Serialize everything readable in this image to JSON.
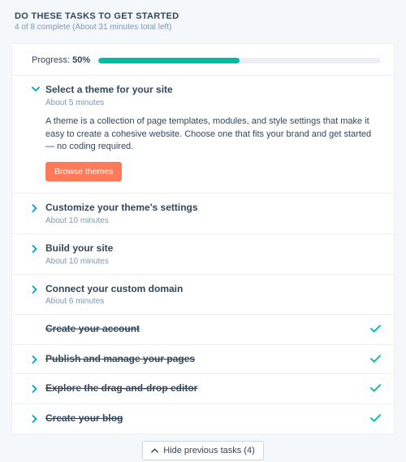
{
  "header": {
    "title": "DO THESE TASKS TO GET STARTED",
    "subtitle": "4 of 8 complete (About 31 minutes total left)"
  },
  "progress": {
    "label_prefix": "Progress: ",
    "percent_text": "50%",
    "percent_value": 50
  },
  "tasks": [
    {
      "title": "Select a theme for your site",
      "time": "About 5 minutes",
      "expanded": true,
      "completed": false,
      "description": "A theme is a collection of page templates, modules, and style settings that make it easy to create a cohesive website. Choose one that fits your brand and get started — no coding required.",
      "cta": "Browse themes"
    },
    {
      "title": "Customize your theme's settings",
      "time": "About 10 minutes",
      "expanded": false,
      "completed": false
    },
    {
      "title": "Build your site",
      "time": "About 10 minutes",
      "expanded": false,
      "completed": false
    },
    {
      "title": "Connect your custom domain",
      "time": "About 6 minutes",
      "expanded": false,
      "completed": false
    },
    {
      "title": "Create your account",
      "expanded": false,
      "completed": true,
      "has_chevron": false
    },
    {
      "title": "Publish and manage your pages",
      "expanded": false,
      "completed": true
    },
    {
      "title": "Explore the drag-and-drop editor",
      "expanded": false,
      "completed": true
    },
    {
      "title": "Create your blog",
      "expanded": false,
      "completed": true
    }
  ],
  "hide_previous": {
    "label": "Hide previous tasks (4)"
  },
  "colors": {
    "accent": "#00a4bd",
    "success": "#00bda5",
    "primary_button": "#ff7a59"
  }
}
